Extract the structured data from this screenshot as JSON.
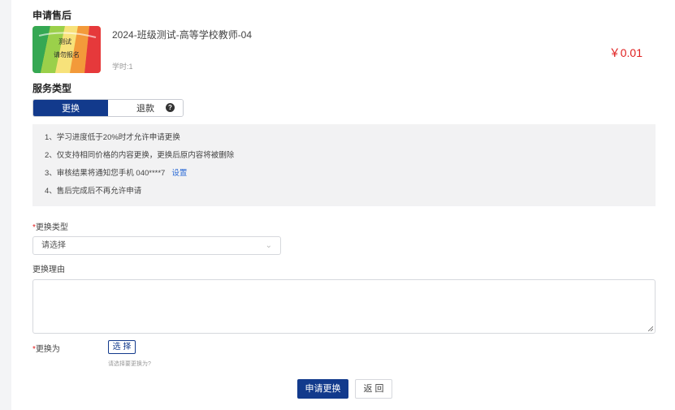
{
  "page": {
    "title": "申请售后"
  },
  "product": {
    "name": "2024-班级测试-高等学校教师-04",
    "hours": "学时:1",
    "price": "￥0.01",
    "thumbnail": {
      "icon": "course-cover-image",
      "text_top": "测试",
      "text_bottom": "请勿报名"
    }
  },
  "service_type": {
    "title": "服务类型",
    "options": [
      "更换",
      "退款"
    ],
    "selected": "更换",
    "help_icon": "question-circle-icon"
  },
  "notice": {
    "lines": [
      "1、学习进度低于20%时才允许申请更换",
      "2、仅支持相同价格的内容更换，更换后原内容将被删除",
      "3、审核结果将通知您手机 040****7",
      "4、售后完成后不再允许申请"
    ],
    "link_label": "设置"
  },
  "form": {
    "exchange_type_label": "更换类型",
    "exchange_type_placeholder": "请选择",
    "reason_label": "更换理由",
    "reason_value": "",
    "exchange_to_label": "更换为",
    "choose_button": "选 择",
    "choose_hint": "请选择要更换为?"
  },
  "actions": {
    "submit": "申请更换",
    "back": "返 回"
  },
  "colors": {
    "primary": "#123a8c",
    "price": "#e02020",
    "link": "#2c6bd6",
    "required": "#e02020"
  }
}
